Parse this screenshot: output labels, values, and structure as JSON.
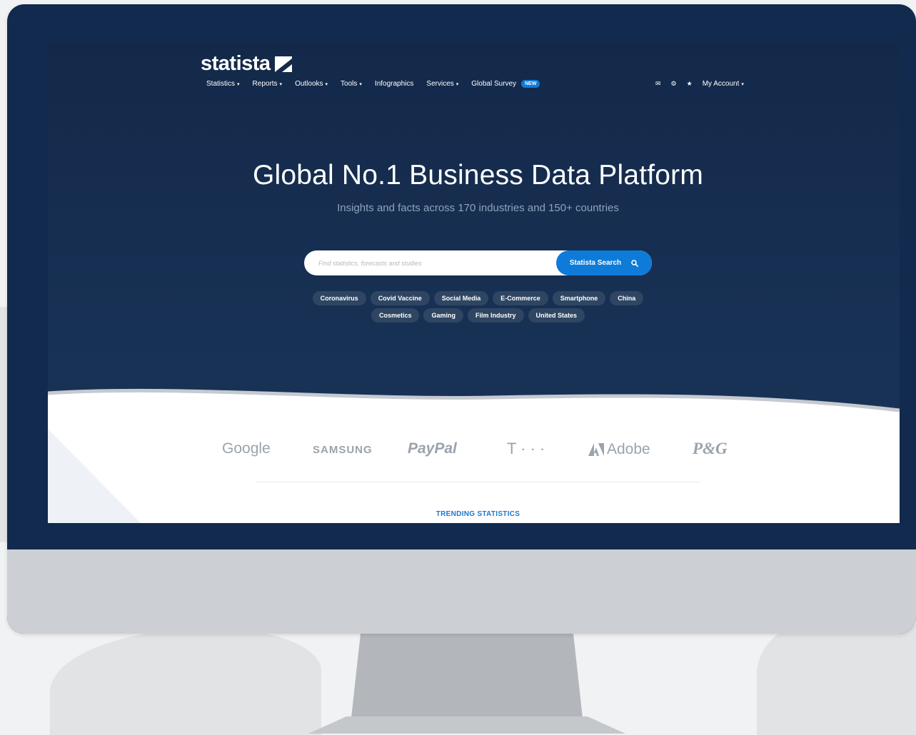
{
  "header": {
    "logo_text": "statista",
    "nav": [
      {
        "label": "Statistics",
        "caret": "▾"
      },
      {
        "label": "Reports",
        "caret": "▾"
      },
      {
        "label": "Outlooks",
        "caret": "▾"
      },
      {
        "label": "Tools",
        "caret": "▾"
      },
      {
        "label": "Infographics",
        "caret": ""
      },
      {
        "label": "Services",
        "caret": "▾"
      },
      {
        "label": "Global Survey",
        "caret": ""
      }
    ],
    "new_badge": "NEW",
    "right_icons": {
      "mail": "✉",
      "settings": "⚙",
      "star": "★"
    },
    "account_label": "My Account",
    "account_caret": "▾"
  },
  "hero": {
    "headline": "Global No.1 Business Data Platform",
    "subline": "Insights and facts across 170 industries and 150+ countries"
  },
  "search": {
    "placeholder": "Find statistics, forecasts and studies",
    "value": "",
    "button_label": "Statista Search"
  },
  "chips": {
    "row1": [
      "Coronavirus",
      "Covid Vaccine",
      "Social Media",
      "E-Commerce",
      "Smartphone",
      "China"
    ],
    "row2": [
      "Cosmetics",
      "Gaming",
      "Film Industry",
      "United States"
    ]
  },
  "brands": {
    "google": "Google",
    "samsung": "SAMSUNG",
    "paypal": "PayPal",
    "telekom": "T · · ·",
    "adobe": "Adobe",
    "pg": "P&G"
  },
  "trending_label": "TRENDING STATISTICS",
  "colors": {
    "hero_bg": "#14294a",
    "accent": "#0f7bd9",
    "chip_bg": "#2f4663",
    "brand_gray": "#9aa3ad",
    "frame": "#112a4d"
  }
}
